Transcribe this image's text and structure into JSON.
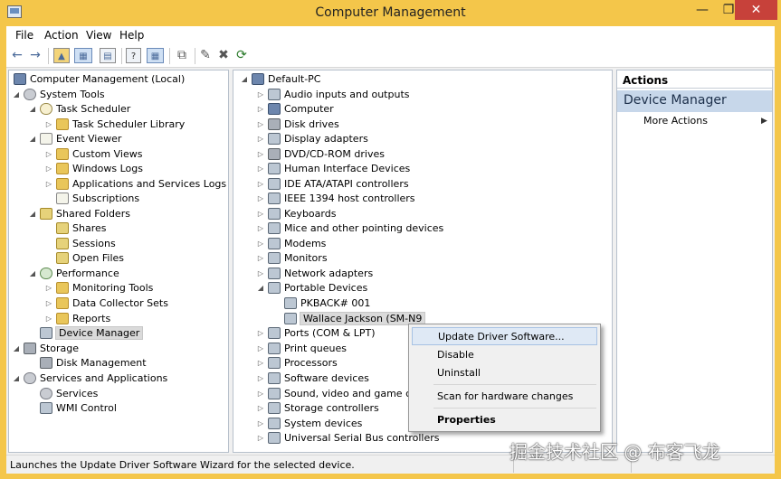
{
  "window": {
    "title": "Computer Management",
    "min": "—",
    "max": "❐",
    "close": "✕"
  },
  "menu": [
    "File",
    "Action",
    "View",
    "Help"
  ],
  "toolbar": [
    "←",
    "→",
    "▲",
    "▦",
    "▤",
    "?",
    "▦",
    "⧉",
    "✎",
    "✖",
    "⟳"
  ],
  "left_tree": [
    {
      "label": "Computer Management (Local)",
      "icon": "pc-icon",
      "exp": ""
    },
    {
      "label": "System Tools",
      "icon": "tools-icon",
      "exp": "◢"
    },
    {
      "label": "Task Scheduler",
      "icon": "clock-icon",
      "exp": "◢"
    },
    {
      "label": "Task Scheduler Library",
      "icon": "folder-icon",
      "exp": "▷"
    },
    {
      "label": "Event Viewer",
      "icon": "event-viewer-icon",
      "exp": "◢"
    },
    {
      "label": "Custom Views",
      "icon": "folder-icon",
      "exp": "▷"
    },
    {
      "label": "Windows Logs",
      "icon": "folder-icon",
      "exp": "▷"
    },
    {
      "label": "Applications and Services Logs",
      "icon": "folder-icon",
      "exp": "▷"
    },
    {
      "label": "Subscriptions",
      "icon": "log-icon",
      "exp": ""
    },
    {
      "label": "Shared Folders",
      "icon": "shared-folder-icon",
      "exp": "◢"
    },
    {
      "label": "Shares",
      "icon": "shared-folder-icon",
      "exp": ""
    },
    {
      "label": "Sessions",
      "icon": "shared-folder-icon",
      "exp": ""
    },
    {
      "label": "Open Files",
      "icon": "shared-folder-icon",
      "exp": ""
    },
    {
      "label": "Performance",
      "icon": "performance-icon",
      "exp": "◢"
    },
    {
      "label": "Monitoring Tools",
      "icon": "folder-icon",
      "exp": "▷"
    },
    {
      "label": "Data Collector Sets",
      "icon": "folder-icon",
      "exp": "▷"
    },
    {
      "label": "Reports",
      "icon": "folder-icon",
      "exp": "▷"
    },
    {
      "label": "Device Manager",
      "icon": "device-manager-icon",
      "exp": ""
    },
    {
      "label": "Storage",
      "icon": "storage-icon",
      "exp": "◢"
    },
    {
      "label": "Disk Management",
      "icon": "disk-icon",
      "exp": ""
    },
    {
      "label": "Services and Applications",
      "icon": "services-icon",
      "exp": "◢"
    },
    {
      "label": "Services",
      "icon": "gear-icon",
      "exp": ""
    },
    {
      "label": "WMI Control",
      "icon": "wmi-icon",
      "exp": ""
    }
  ],
  "device_tree": [
    {
      "label": "Default-PC",
      "exp": "◢",
      "icon": "computer-icon"
    },
    {
      "label": "Audio inputs and outputs",
      "exp": "▷",
      "icon": "speaker-icon"
    },
    {
      "label": "Computer",
      "exp": "▷",
      "icon": "computer-icon"
    },
    {
      "label": "Disk drives",
      "exp": "▷",
      "icon": "disk-icon"
    },
    {
      "label": "Display adapters",
      "exp": "▷",
      "icon": "display-icon"
    },
    {
      "label": "DVD/CD-ROM drives",
      "exp": "▷",
      "icon": "dvd-icon"
    },
    {
      "label": "Human Interface Devices",
      "exp": "▷",
      "icon": "hid-icon"
    },
    {
      "label": "IDE ATA/ATAPI controllers",
      "exp": "▷",
      "icon": "ide-icon"
    },
    {
      "label": "IEEE 1394 host controllers",
      "exp": "▷",
      "icon": "ieee1394-icon"
    },
    {
      "label": "Keyboards",
      "exp": "▷",
      "icon": "keyboard-icon"
    },
    {
      "label": "Mice and other pointing devices",
      "exp": "▷",
      "icon": "mouse-icon"
    },
    {
      "label": "Modems",
      "exp": "▷",
      "icon": "modem-icon"
    },
    {
      "label": "Monitors",
      "exp": "▷",
      "icon": "monitor-icon"
    },
    {
      "label": "Network adapters",
      "exp": "▷",
      "icon": "network-icon"
    },
    {
      "label": "Portable Devices",
      "exp": "◢",
      "icon": "portable-device-icon"
    },
    {
      "label": "PKBACK# 001",
      "exp": "",
      "icon": "portable-device-icon"
    },
    {
      "label": "Wallace Jackson (SM-N9",
      "exp": "",
      "icon": "portable-device-icon"
    },
    {
      "label": "Ports (COM & LPT)",
      "exp": "▷",
      "icon": "port-icon"
    },
    {
      "label": "Print queues",
      "exp": "▷",
      "icon": "printer-icon"
    },
    {
      "label": "Processors",
      "exp": "▷",
      "icon": "processor-icon"
    },
    {
      "label": "Software devices",
      "exp": "▷",
      "icon": "software-device-icon"
    },
    {
      "label": "Sound, video and game con",
      "exp": "▷",
      "icon": "sound-icon"
    },
    {
      "label": "Storage controllers",
      "exp": "▷",
      "icon": "storage-controller-icon"
    },
    {
      "label": "System devices",
      "exp": "▷",
      "icon": "system-device-icon"
    },
    {
      "label": "Universal Serial Bus controllers",
      "exp": "▷",
      "icon": "usb-icon"
    }
  ],
  "actions": {
    "header": "Actions",
    "section": "Device Manager",
    "more": "More Actions",
    "arrow": "▶"
  },
  "context_menu": {
    "update": "Update Driver Software...",
    "disable": "Disable",
    "uninstall": "Uninstall",
    "scan": "Scan for hardware changes",
    "properties": "Properties"
  },
  "status": "Launches the Update Driver Software Wizard for the selected device.",
  "watermark": "掘金技术社区 @ 布客飞龙",
  "colors": {
    "title_bar": "#f4c64a",
    "close_button": "#c7413a",
    "actions_section": "#c7d7ea",
    "selection": "#dadada"
  }
}
